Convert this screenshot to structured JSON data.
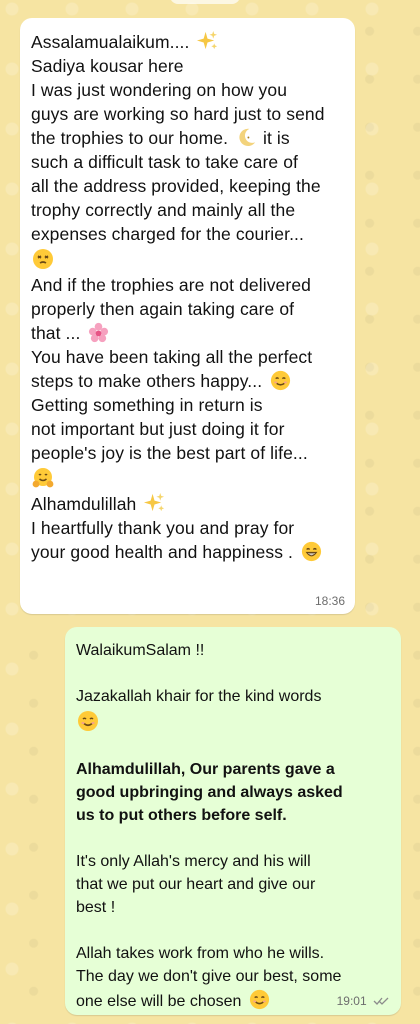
{
  "conversation": {
    "incoming": {
      "lines": [
        "Assalamualaikum....",
        "Sadiya kousar here",
        "I was just wondering on how you",
        "guys are working so hard just to send",
        "the trophies to our home.",
        "it is",
        "such a difficult task to take care of",
        "all the address provided, keeping the",
        "trophy correctly and mainly all the",
        "expenses charged for the courier...",
        "And if the trophies are not delivered",
        "properly then again taking care of",
        "that ...",
        "You have been taking all the perfect",
        "steps to make others happy...",
        "Getting something in return is",
        "not important but just doing it for",
        "people's joy is the best part of life...",
        "Alhamdulillah",
        "I heartfully thank you and pray for",
        "your good health and happiness ."
      ],
      "time": "18:36"
    },
    "outgoing": {
      "lines": [
        "WalaikumSalam !!",
        "Jazakallah khair for the kind words",
        "Alhamdulillah, Our parents gave a",
        "good upbringing and always asked",
        "us to put others before self.",
        "It's only Allah's mercy and his will",
        "that we put our heart and give our",
        "best !",
        "Allah takes work from who he wills.",
        "The day we don't give our best, some",
        "one else will be chosen"
      ],
      "time": "19:01"
    }
  },
  "icons": {
    "sparkles": "sparkles-icon",
    "moon": "crescent-moon-icon",
    "dizzy": "dizzy-face-icon",
    "flower": "cherry-blossom-icon",
    "blush": "smiling-face-icon",
    "hug": "hugging-face-icon",
    "grin": "grinning-face-icon",
    "smile": "smiling-face-icon",
    "read": "double-check-icon"
  },
  "colors": {
    "wallpaper": "#f6e4a2",
    "incoming_bubble": "#ffffff",
    "outgoing_bubble": "#e6ffd6",
    "timestamp": "#6d6d6d"
  }
}
